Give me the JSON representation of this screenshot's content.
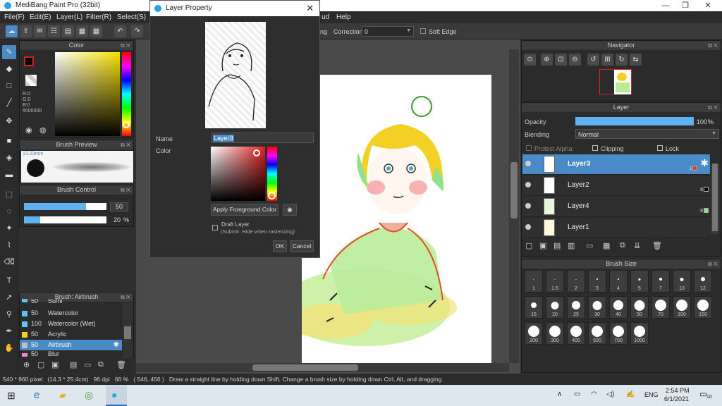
{
  "app": {
    "title": "MediBang Paint Pro (32bit)"
  },
  "window_controls": {
    "minimize": "—",
    "maximize": "❐",
    "close": "✕"
  },
  "menu": [
    "File(F)",
    "Edit(E)",
    "Layer(L)",
    "Filter(R)",
    "Select(S)",
    "ud",
    "Help"
  ],
  "toolbar": {
    "hidden_label": "ng",
    "correction_label": "Correction",
    "correction_value": "0",
    "soft_edge_label": "Soft Edge"
  },
  "color_panel": {
    "title": "Color",
    "r": "R:0",
    "g": "G:0",
    "b": "B:0",
    "hex": "#000000"
  },
  "brush_preview": {
    "title": "Brush Preview",
    "size": "13.23mm"
  },
  "brush_control": {
    "title": "Brush Control",
    "size_value": "50",
    "opacity_value": "20",
    "opacity_unit": "%",
    "size_fill": 0.75,
    "opacity_fill": 0.2
  },
  "brush_list": {
    "title": "Brush: Airbrush",
    "items": [
      {
        "value": "50",
        "name": "Sumi",
        "color": "#5fc3f7"
      },
      {
        "value": "50",
        "name": "Watercolor",
        "color": "#5fc3f7"
      },
      {
        "value": "100",
        "name": "Watercolor (Wet)",
        "color": "#5fc3f7"
      },
      {
        "value": "50",
        "name": "Acrylic",
        "color": "#f2d024"
      },
      {
        "value": "50",
        "name": "Airbrush",
        "color": "#c0c0c0",
        "selected": true
      },
      {
        "value": "50",
        "name": "Blur",
        "color": "#f08ad0"
      }
    ]
  },
  "dialog": {
    "title": "Layer Property",
    "name_label": "Name",
    "name_value": "Layer3",
    "color_label": "Color",
    "apply_fg": "Apply Foreground Color",
    "draft_label": "Draft Layer",
    "draft_note": "(Submit· Hide when rasterizing)",
    "ok": "OK",
    "cancel": "Cancel"
  },
  "navigator": {
    "title": "Navigator"
  },
  "layer_panel": {
    "title": "Layer",
    "opacity_label": "Opacity",
    "opacity_value": "100",
    "opacity_unit": "%",
    "blending_label": "Blending",
    "blending_value": "Normal",
    "protect_alpha": "Protect Alpha",
    "clipping": "Clipping",
    "lock": "Lock",
    "layers": [
      {
        "name": "Layer3",
        "num": "1",
        "swatch": "#e04020",
        "selected": true
      },
      {
        "name": "Layer2",
        "num": "8",
        "swatch": "#000000"
      },
      {
        "name": "Layer4",
        "num": "8",
        "swatch": "#8fe08f"
      },
      {
        "name": "Layer1",
        "num": "",
        "swatch": ""
      }
    ]
  },
  "brush_size": {
    "title": "Brush Size",
    "sizes": [
      "1",
      "1.5",
      "2",
      "3",
      "4",
      "5",
      "7",
      "10",
      "12",
      "15",
      "20",
      "25",
      "30",
      "40",
      "50",
      "70",
      "100",
      "150",
      "200",
      "300",
      "400",
      "500",
      "700",
      "1000"
    ]
  },
  "status": {
    "dimensions": "540 * 960 pixel",
    "physical": "(14.3 * 25.4cm)",
    "dpi": "96 dpi",
    "zoom": "66 %",
    "coords": "( 546, 456 )",
    "hint": "Draw a straight line by holding down Shift, Change a brush size by holding down Ctrl, Alt, and dragging"
  },
  "taskbar": {
    "time": "2:54 PM",
    "date": "6/1/2021",
    "lang": "ENG",
    "notifications": "10"
  }
}
